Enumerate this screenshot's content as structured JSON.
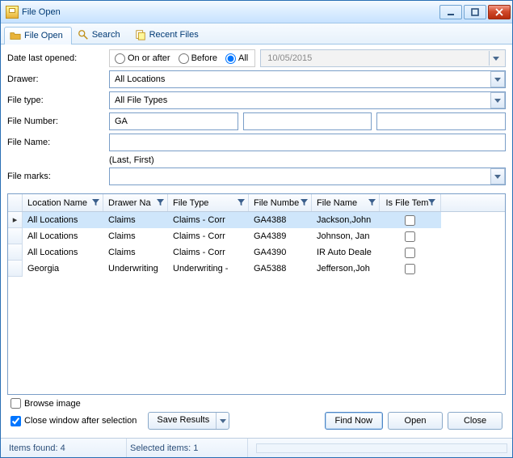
{
  "window": {
    "title": "File Open"
  },
  "tabs": [
    {
      "label": "File Open",
      "icon": "folder-open-icon"
    },
    {
      "label": "Search",
      "icon": "search-icon"
    },
    {
      "label": "Recent Files",
      "icon": "recent-icon"
    }
  ],
  "form": {
    "date_label": "Date last opened:",
    "date_radio": {
      "on_or_after": "On or after",
      "before": "Before",
      "all": "All",
      "selected": "all"
    },
    "date_value": "10/05/2015",
    "drawer_label": "Drawer:",
    "drawer_value": "All Locations",
    "filetype_label": "File type:",
    "filetype_value": "All File Types",
    "filenum_label": "File Number:",
    "filenum_value": "GA",
    "filenum2_value": "",
    "filenum3_value": "",
    "filename_label": "File Name:",
    "filename_value": "",
    "filename_hint": "(Last, First)",
    "filemarks_label": "File marks:",
    "filemarks_value": ""
  },
  "grid": {
    "columns": [
      {
        "label": "Location Name"
      },
      {
        "label": "Drawer Na"
      },
      {
        "label": "File Type"
      },
      {
        "label": "File Numbe"
      },
      {
        "label": "File Name"
      },
      {
        "label": "Is File Tem"
      }
    ],
    "rows": [
      {
        "loc": "All Locations",
        "drawer": "Claims",
        "ftype": "Claims - Corr",
        "fnum": "GA4388",
        "fname": "Jackson,John",
        "tmpl": false,
        "selected": true
      },
      {
        "loc": "All Locations",
        "drawer": "Claims",
        "ftype": "Claims - Corr",
        "fnum": "GA4389",
        "fname": "Johnson, Jan",
        "tmpl": false,
        "selected": false
      },
      {
        "loc": "All Locations",
        "drawer": "Claims",
        "ftype": "Claims - Corr",
        "fnum": "GA4390",
        "fname": "IR Auto Deale",
        "tmpl": false,
        "selected": false
      },
      {
        "loc": "Georgia",
        "drawer": "Underwriting",
        "ftype": "Underwriting -",
        "fnum": "GA5388",
        "fname": "Jefferson,Joh",
        "tmpl": false,
        "selected": false
      }
    ]
  },
  "footer": {
    "browse_image": "Browse image",
    "browse_checked": false,
    "close_after": "Close window after selection",
    "close_after_checked": true,
    "save_results": "Save Results",
    "find_now": "Find Now",
    "open": "Open",
    "close": "Close"
  },
  "status": {
    "items_found": "Items found: 4",
    "selected_items": "Selected items: 1"
  }
}
